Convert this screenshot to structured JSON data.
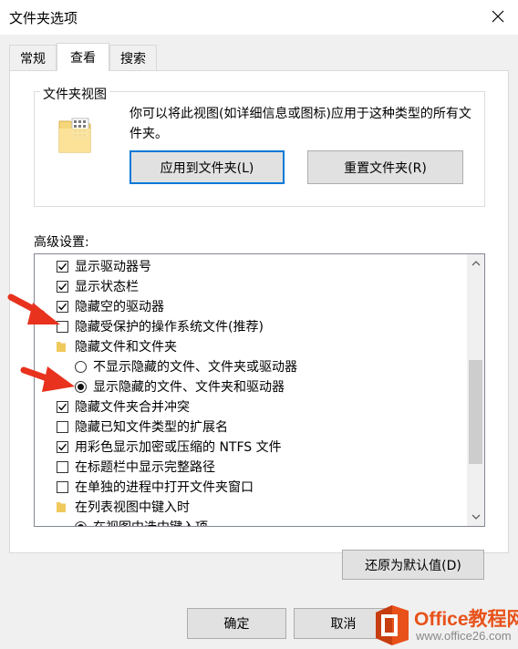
{
  "window": {
    "title": "文件夹选项",
    "close_icon": "close-icon"
  },
  "tabs": [
    {
      "label": "常规",
      "active": false
    },
    {
      "label": "查看",
      "active": true
    },
    {
      "label": "搜索",
      "active": false
    }
  ],
  "folder_views": {
    "legend": "文件夹视图",
    "description": "你可以将此视图(如详细信息或图标)应用于这种类型的所有文件夹。",
    "apply_button": "应用到文件夹(L)",
    "reset_button": "重置文件夹(R)",
    "icon": "folder-view-icon"
  },
  "advanced": {
    "label": "高级设置:",
    "items": [
      {
        "type": "checkbox",
        "checked": true,
        "label": "显示驱动器号"
      },
      {
        "type": "checkbox",
        "checked": true,
        "label": "显示状态栏"
      },
      {
        "type": "checkbox",
        "checked": true,
        "label": "隐藏空的驱动器"
      },
      {
        "type": "checkbox",
        "checked": false,
        "label": "隐藏受保护的操作系统文件(推荐)"
      },
      {
        "type": "folder",
        "label": "隐藏文件和文件夹"
      },
      {
        "type": "radio",
        "checked": false,
        "label": "不显示隐藏的文件、文件夹或驱动器"
      },
      {
        "type": "radio",
        "checked": true,
        "label": "显示隐藏的文件、文件夹和驱动器"
      },
      {
        "type": "checkbox",
        "checked": true,
        "label": "隐藏文件夹合并冲突"
      },
      {
        "type": "checkbox",
        "checked": false,
        "label": "隐藏已知文件类型的扩展名"
      },
      {
        "type": "checkbox",
        "checked": true,
        "label": "用彩色显示加密或压缩的 NTFS 文件"
      },
      {
        "type": "checkbox",
        "checked": false,
        "label": "在标题栏中显示完整路径"
      },
      {
        "type": "checkbox",
        "checked": false,
        "label": "在单独的进程中打开文件夹窗口"
      },
      {
        "type": "folder",
        "label": "在列表视图中键入时"
      },
      {
        "type": "radio",
        "checked": true,
        "label": "在视图中选中键入项"
      }
    ],
    "restore_button": "还原为默认值(D)"
  },
  "footer": {
    "ok_button": "确定",
    "cancel_button": "取消"
  },
  "watermark": {
    "brand": "Office教程网",
    "url": "www.office26.com"
  },
  "colors": {
    "accent": "#0078d7",
    "annotation_arrow": "#e8321e",
    "watermark_orange": "#e8521a"
  }
}
